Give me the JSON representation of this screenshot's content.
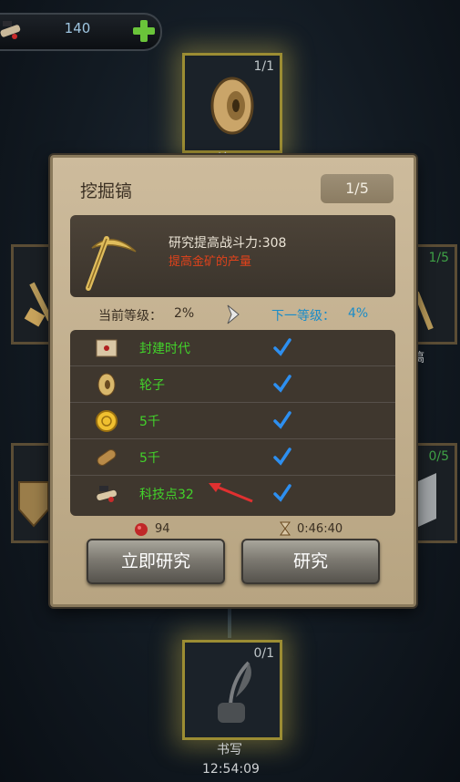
{
  "resources": {
    "value": "140"
  },
  "nodes": {
    "top": {
      "count": "1/1",
      "name": "轮子"
    },
    "left_mid": {},
    "right_mid": {
      "count": "1/5",
      "name": "搞"
    },
    "left_low": {},
    "right_low": {
      "count": "0/5"
    },
    "bottom": {
      "count": "0/1",
      "name": "书写",
      "timer": "12:54:09"
    }
  },
  "dialog": {
    "title": "挖掘镐",
    "level": "1/5",
    "desc": {
      "line1": "研究提高战斗力:308",
      "line2": "提高金矿的产量"
    },
    "current_label": "当前等级：",
    "current_value": "2%",
    "next_label": "下一等级：",
    "next_value": "4%",
    "requirements": [
      {
        "label": "封建时代",
        "icon": "map-scroll-icon"
      },
      {
        "label": "轮子",
        "icon": "wheel-icon"
      },
      {
        "label": "5千",
        "icon": "gold-coin-icon"
      },
      {
        "label": "5千",
        "icon": "wood-log-icon"
      },
      {
        "label": "科技点32",
        "icon": "tech-scroll-icon"
      }
    ],
    "cost": {
      "food": "94",
      "time": "0:46:40"
    },
    "buttons": {
      "instant": "立即研究",
      "research": "研究"
    }
  },
  "colors": {
    "requirement_text": "#42d22b",
    "next_level": "#1a8cc8",
    "bonus_text": "#e0421b",
    "node_glow": "#e0c950"
  }
}
